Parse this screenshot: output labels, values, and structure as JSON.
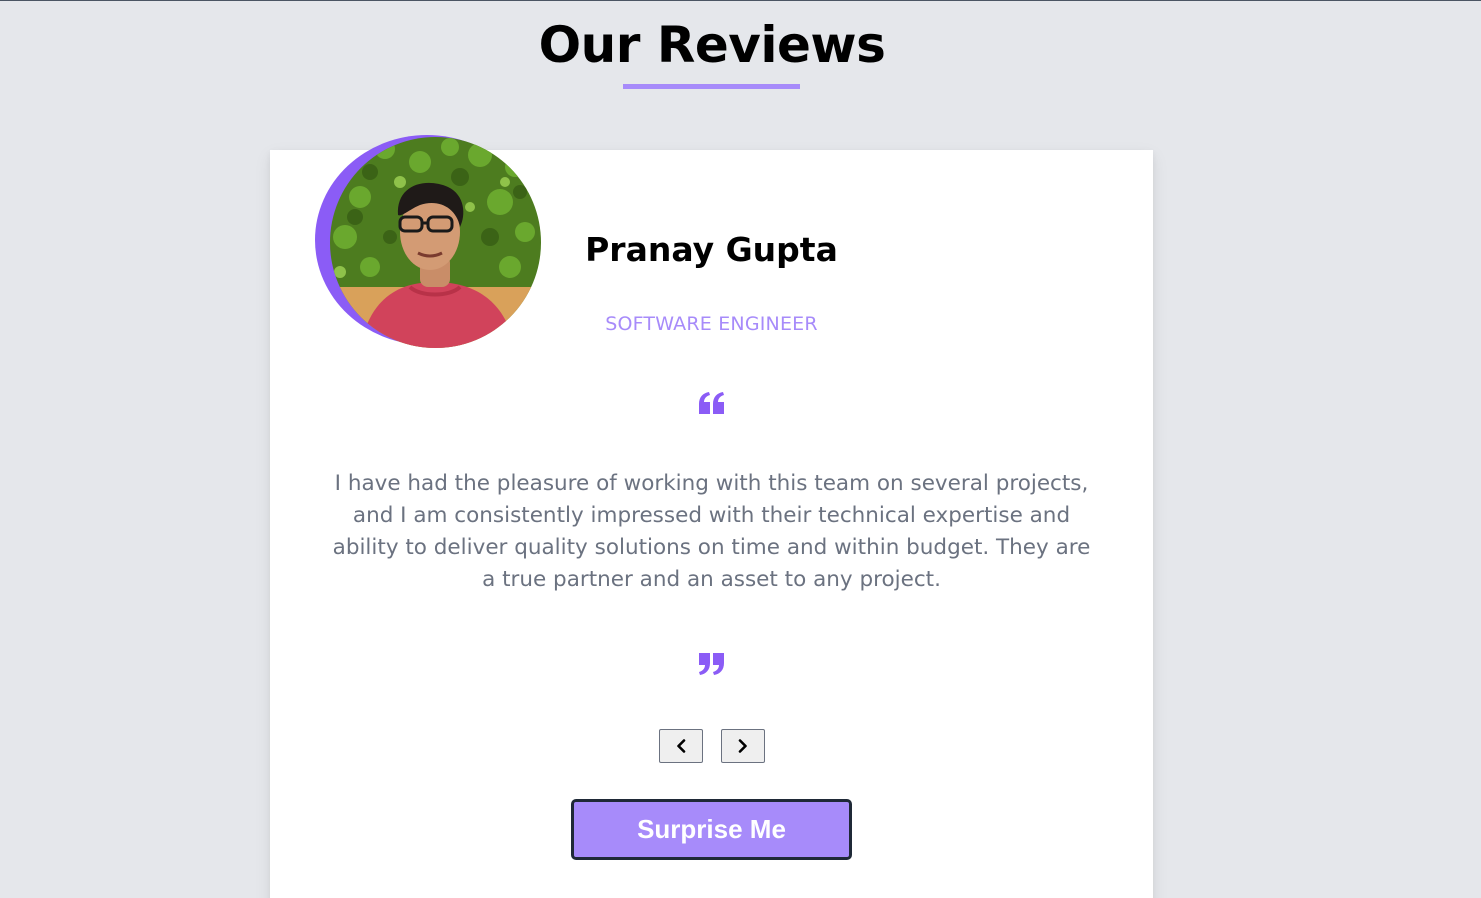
{
  "section": {
    "title": "Our Reviews",
    "accent_color": "#a78bfa"
  },
  "review": {
    "name": "Pranay Gupta",
    "job": "SOFTWARE ENGINEER",
    "text": "I have had the pleasure of working with this team on several projects, and I am consistently impressed with their technical expertise and ability to deliver quality solutions on time and within budget. They are a true partner and an asset to any project.",
    "avatar_ring_color": "#8b5cf6",
    "quote_icon_color": "#8b5cf6"
  },
  "controls": {
    "prev_icon": "chevron-left-icon",
    "next_icon": "chevron-right-icon",
    "surprise_label": "Surprise Me"
  }
}
